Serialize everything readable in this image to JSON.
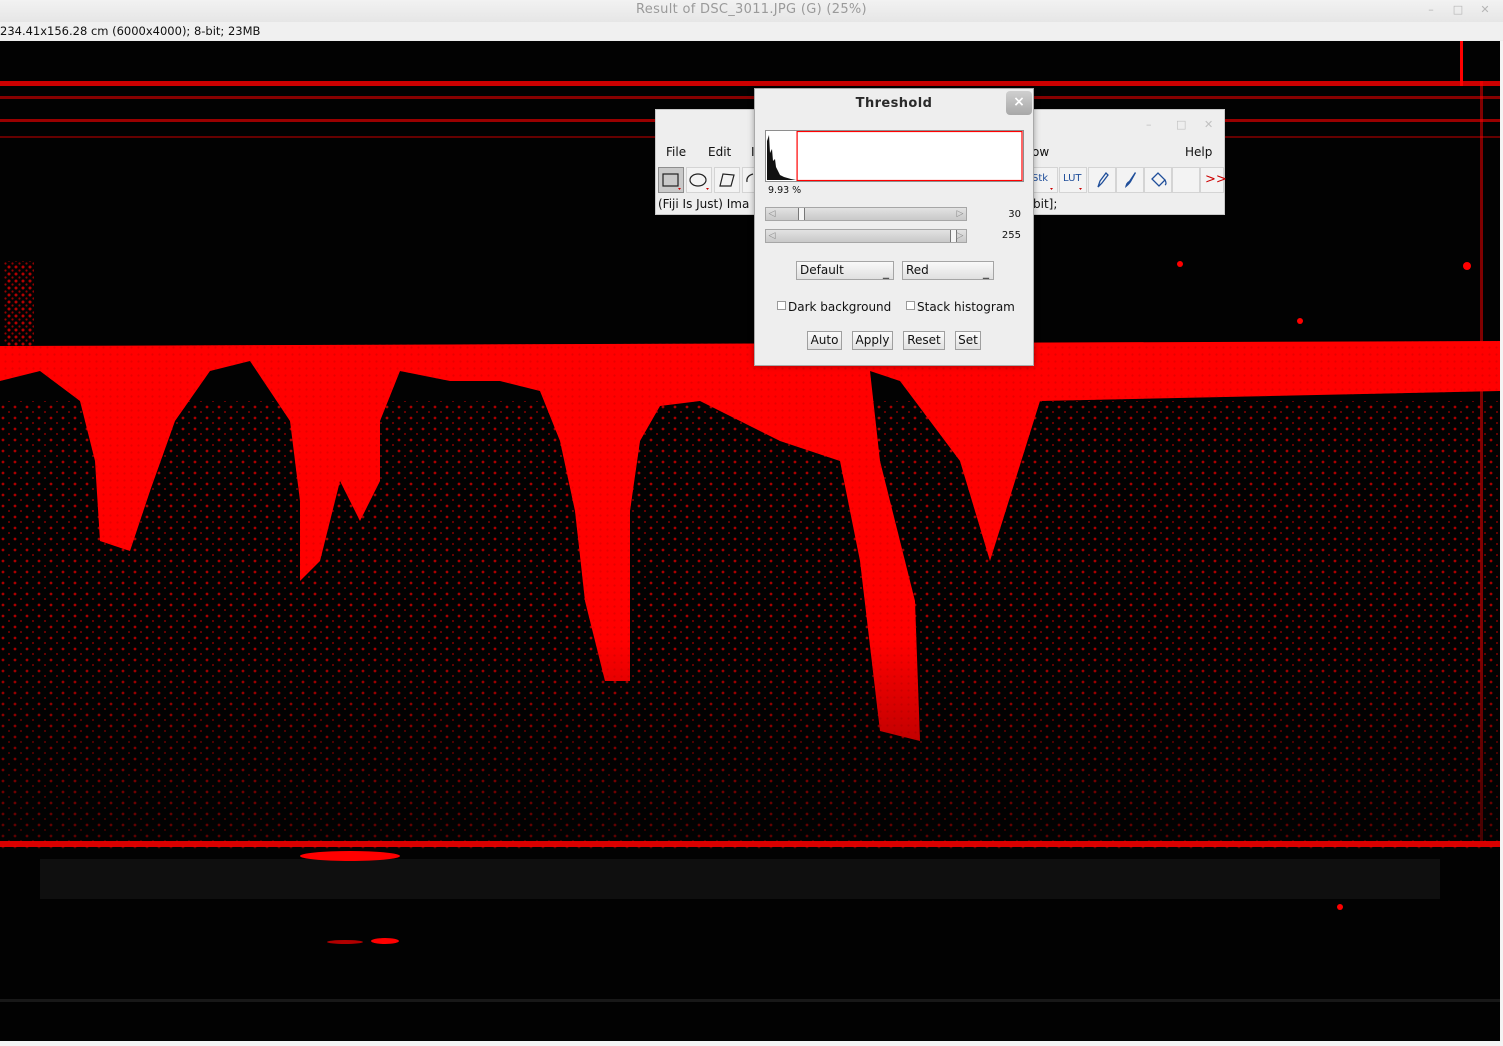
{
  "window": {
    "title": "Result of DSC_3011.JPG (G) (25%)",
    "info": "234.41x156.28 cm (6000x4000); 8-bit; 23MB"
  },
  "fiji": {
    "menu": [
      "File",
      "Edit",
      "I",
      "ow",
      "Help"
    ],
    "tools": [
      "rectangle-tool",
      "oval-tool",
      "polygon-tool",
      "freehand-tool",
      "stk-tool",
      "lut-tool",
      "pencil-tool",
      "brush-tool",
      "flood-fill-tool",
      "blank-tool",
      "more-tools"
    ],
    "stk_label": "Stk",
    "lut_label": "LUT",
    "more_label": ">>",
    "status_left": "(Fiji Is Just) Ima",
    "status_right": "bit];"
  },
  "threshold": {
    "title": "Threshold",
    "close_label": "×",
    "percent": "9.93 %",
    "lower_value": "30",
    "upper_value": "255",
    "lower_fraction": 0.118,
    "upper_fraction": 1.0,
    "method": "Default",
    "display": "Red",
    "dark_background_label": "Dark background",
    "dark_background_checked": false,
    "stack_histogram_label": "Stack histogram",
    "stack_histogram_checked": false,
    "buttons": [
      "Auto",
      "Apply",
      "Reset",
      "Set"
    ],
    "overlay_color": "#ff0000"
  }
}
